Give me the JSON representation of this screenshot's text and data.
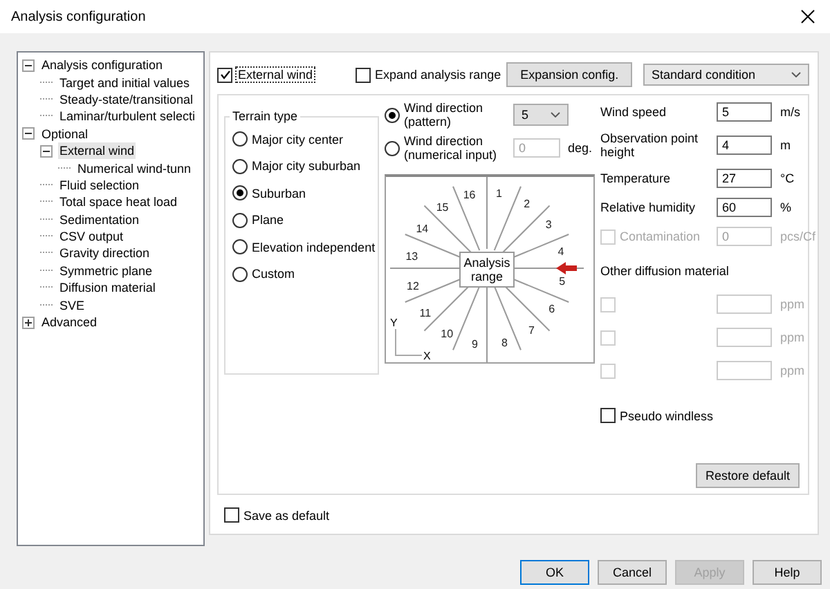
{
  "window": {
    "title": "Analysis configuration"
  },
  "tree": [
    {
      "label": "Analysis configuration",
      "expanded": true,
      "selected": false,
      "children": [
        {
          "label": "Target and initial values",
          "selected": false
        },
        {
          "label": "Steady-state/transitional",
          "selected": false
        },
        {
          "label": "Laminar/turbulent selecti",
          "selected": false
        }
      ]
    },
    {
      "label": "Optional",
      "expanded": true,
      "selected": false,
      "children": [
        {
          "label": "External wind",
          "expanded": true,
          "selected": true,
          "children": [
            {
              "label": "Numerical wind-tunn",
              "selected": false
            }
          ]
        },
        {
          "label": "Fluid selection",
          "selected": false
        },
        {
          "label": "Total space heat load",
          "selected": false
        },
        {
          "label": "Sedimentation",
          "selected": false
        },
        {
          "label": "CSV output",
          "selected": false
        },
        {
          "label": "Gravity direction",
          "selected": false
        },
        {
          "label": "Symmetric plane",
          "selected": false
        },
        {
          "label": "Diffusion material",
          "selected": false
        },
        {
          "label": "SVE",
          "selected": false
        }
      ]
    },
    {
      "label": "Advanced",
      "expanded": false,
      "selected": false
    }
  ],
  "top": {
    "external_wind": {
      "label": "External wind",
      "checked": true
    },
    "expand_range": {
      "label": "Expand analysis range",
      "checked": false
    },
    "expansion_button": "Expansion config.",
    "condition_select": {
      "value": "Standard condition"
    }
  },
  "terrain": {
    "title": "Terrain type",
    "options": [
      {
        "label": "Major city center",
        "selected": false
      },
      {
        "label": "Major city suburban",
        "selected": false
      },
      {
        "label": "Suburban",
        "selected": true
      },
      {
        "label": "Plane",
        "selected": false
      },
      {
        "label": "Elevation independent",
        "selected": false
      },
      {
        "label": "Custom",
        "selected": false
      }
    ]
  },
  "wind_direction": {
    "options": [
      {
        "kind": "select",
        "label": "Wind direction (pattern)",
        "selected": true,
        "value": "5",
        "disabled": false
      },
      {
        "kind": "input",
        "label": "Wind direction (numerical input)",
        "selected": false,
        "value": "0",
        "unit": "deg.",
        "disabled": true
      }
    ]
  },
  "diagram": {
    "center_label": "Analysis range",
    "axis_x": "X",
    "axis_y": "Y",
    "directions": [
      {
        "label": "1",
        "selected": false
      },
      {
        "label": "2",
        "selected": false
      },
      {
        "label": "3",
        "selected": false
      },
      {
        "label": "4",
        "selected": false
      },
      {
        "label": "5",
        "selected": true
      },
      {
        "label": "6",
        "selected": false
      },
      {
        "label": "7",
        "selected": false
      },
      {
        "label": "8",
        "selected": false
      },
      {
        "label": "9",
        "selected": false
      },
      {
        "label": "10",
        "selected": false
      },
      {
        "label": "11",
        "selected": false
      },
      {
        "label": "12",
        "selected": false
      },
      {
        "label": "13",
        "selected": false
      },
      {
        "label": "14",
        "selected": false
      },
      {
        "label": "15",
        "selected": false
      },
      {
        "label": "16",
        "selected": false
      }
    ]
  },
  "parameters": [
    {
      "label": "Wind speed",
      "value": "5",
      "unit": "m/s"
    },
    {
      "label": "Observation point height",
      "value": "4",
      "unit": "m"
    },
    {
      "label": "Temperature",
      "value": "27",
      "unit": "°C"
    },
    {
      "label": "Relative humidity",
      "value": "60",
      "unit": "%"
    }
  ],
  "contamination": {
    "label": "Contamination",
    "checked": false,
    "disabled": true,
    "value": "0",
    "unit": "pcs/Cf"
  },
  "other_diffusion": {
    "title": "Other diffusion material",
    "rows": [
      {
        "checked": false,
        "disabled": true,
        "unit": "ppm"
      },
      {
        "checked": false,
        "disabled": true,
        "unit": "ppm"
      },
      {
        "checked": false,
        "disabled": true,
        "unit": "ppm"
      }
    ]
  },
  "pseudo_windless": {
    "label": "Pseudo windless",
    "checked": false
  },
  "restore_button": "Restore default",
  "save_default": {
    "label": "Save as default",
    "checked": false
  },
  "buttons": [
    {
      "label": "OK",
      "default": true,
      "disabled": false
    },
    {
      "label": "Cancel",
      "default": false,
      "disabled": false
    },
    {
      "label": "Apply",
      "default": false,
      "disabled": true
    },
    {
      "label": "Help",
      "default": false,
      "disabled": false
    }
  ]
}
